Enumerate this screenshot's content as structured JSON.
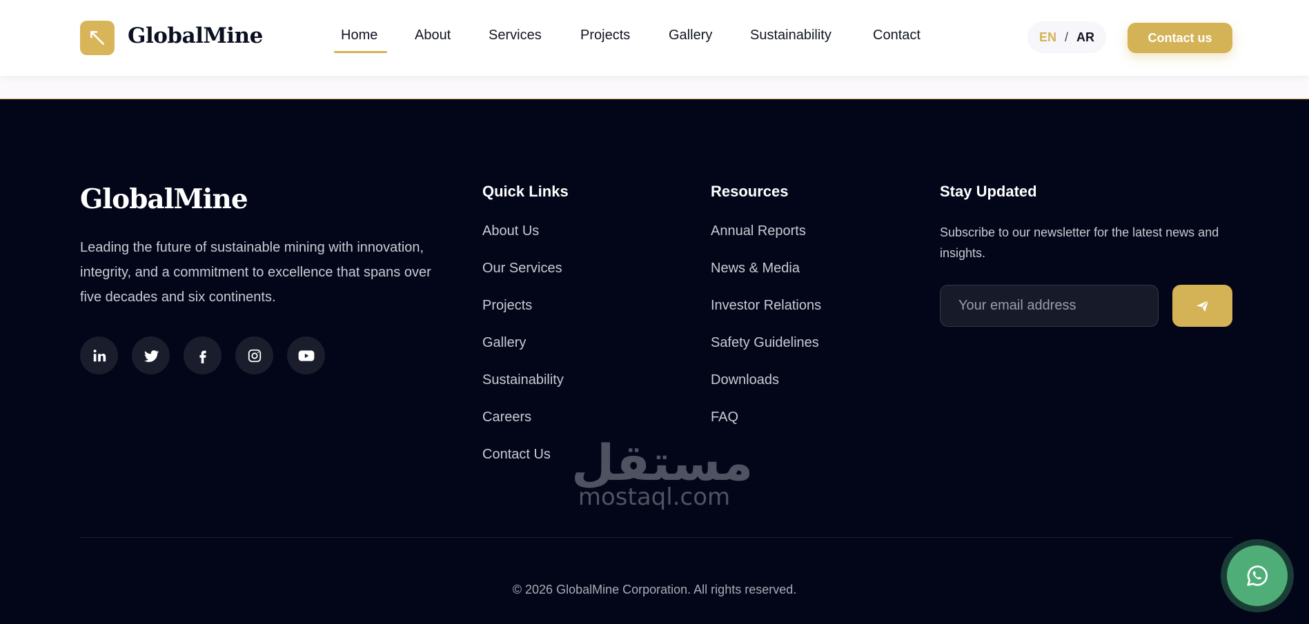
{
  "header": {
    "brand": "GlobalMine",
    "nav": [
      "Home",
      "About",
      "Services",
      "Projects",
      "Gallery",
      "Sustainability",
      "Contact"
    ],
    "active_nav": "Home",
    "lang_en": "EN",
    "lang_sep": "/",
    "lang_ar": "AR",
    "contact_button": "Contact us"
  },
  "footer": {
    "brand": "GlobalMine",
    "description": "Leading the future of sustainable mining with innovation, integrity, and a commitment to excellence that spans over five decades and six continents.",
    "socials": [
      "linkedin-icon",
      "twitter-icon",
      "facebook-icon",
      "instagram-icon",
      "youtube-icon"
    ],
    "quick_links": {
      "title": "Quick Links",
      "items": [
        "About Us",
        "Our Services",
        "Projects",
        "Gallery",
        "Sustainability",
        "Careers",
        "Contact Us"
      ]
    },
    "resources": {
      "title": "Resources",
      "items": [
        "Annual Reports",
        "News & Media",
        "Investor Relations",
        "Safety Guidelines",
        "Downloads",
        "FAQ"
      ]
    },
    "newsletter": {
      "title": "Stay Updated",
      "text": "Subscribe to our newsletter for the latest news and insights.",
      "placeholder": "Your email address"
    },
    "copyright": "© 2026 GlobalMine Corporation. All rights reserved."
  },
  "watermark": {
    "arabic": "مستقل",
    "latin": "mostaql.com"
  },
  "colors": {
    "accent": "#d4b256",
    "footer_bg": "#030619",
    "whatsapp": "#4fae78"
  }
}
